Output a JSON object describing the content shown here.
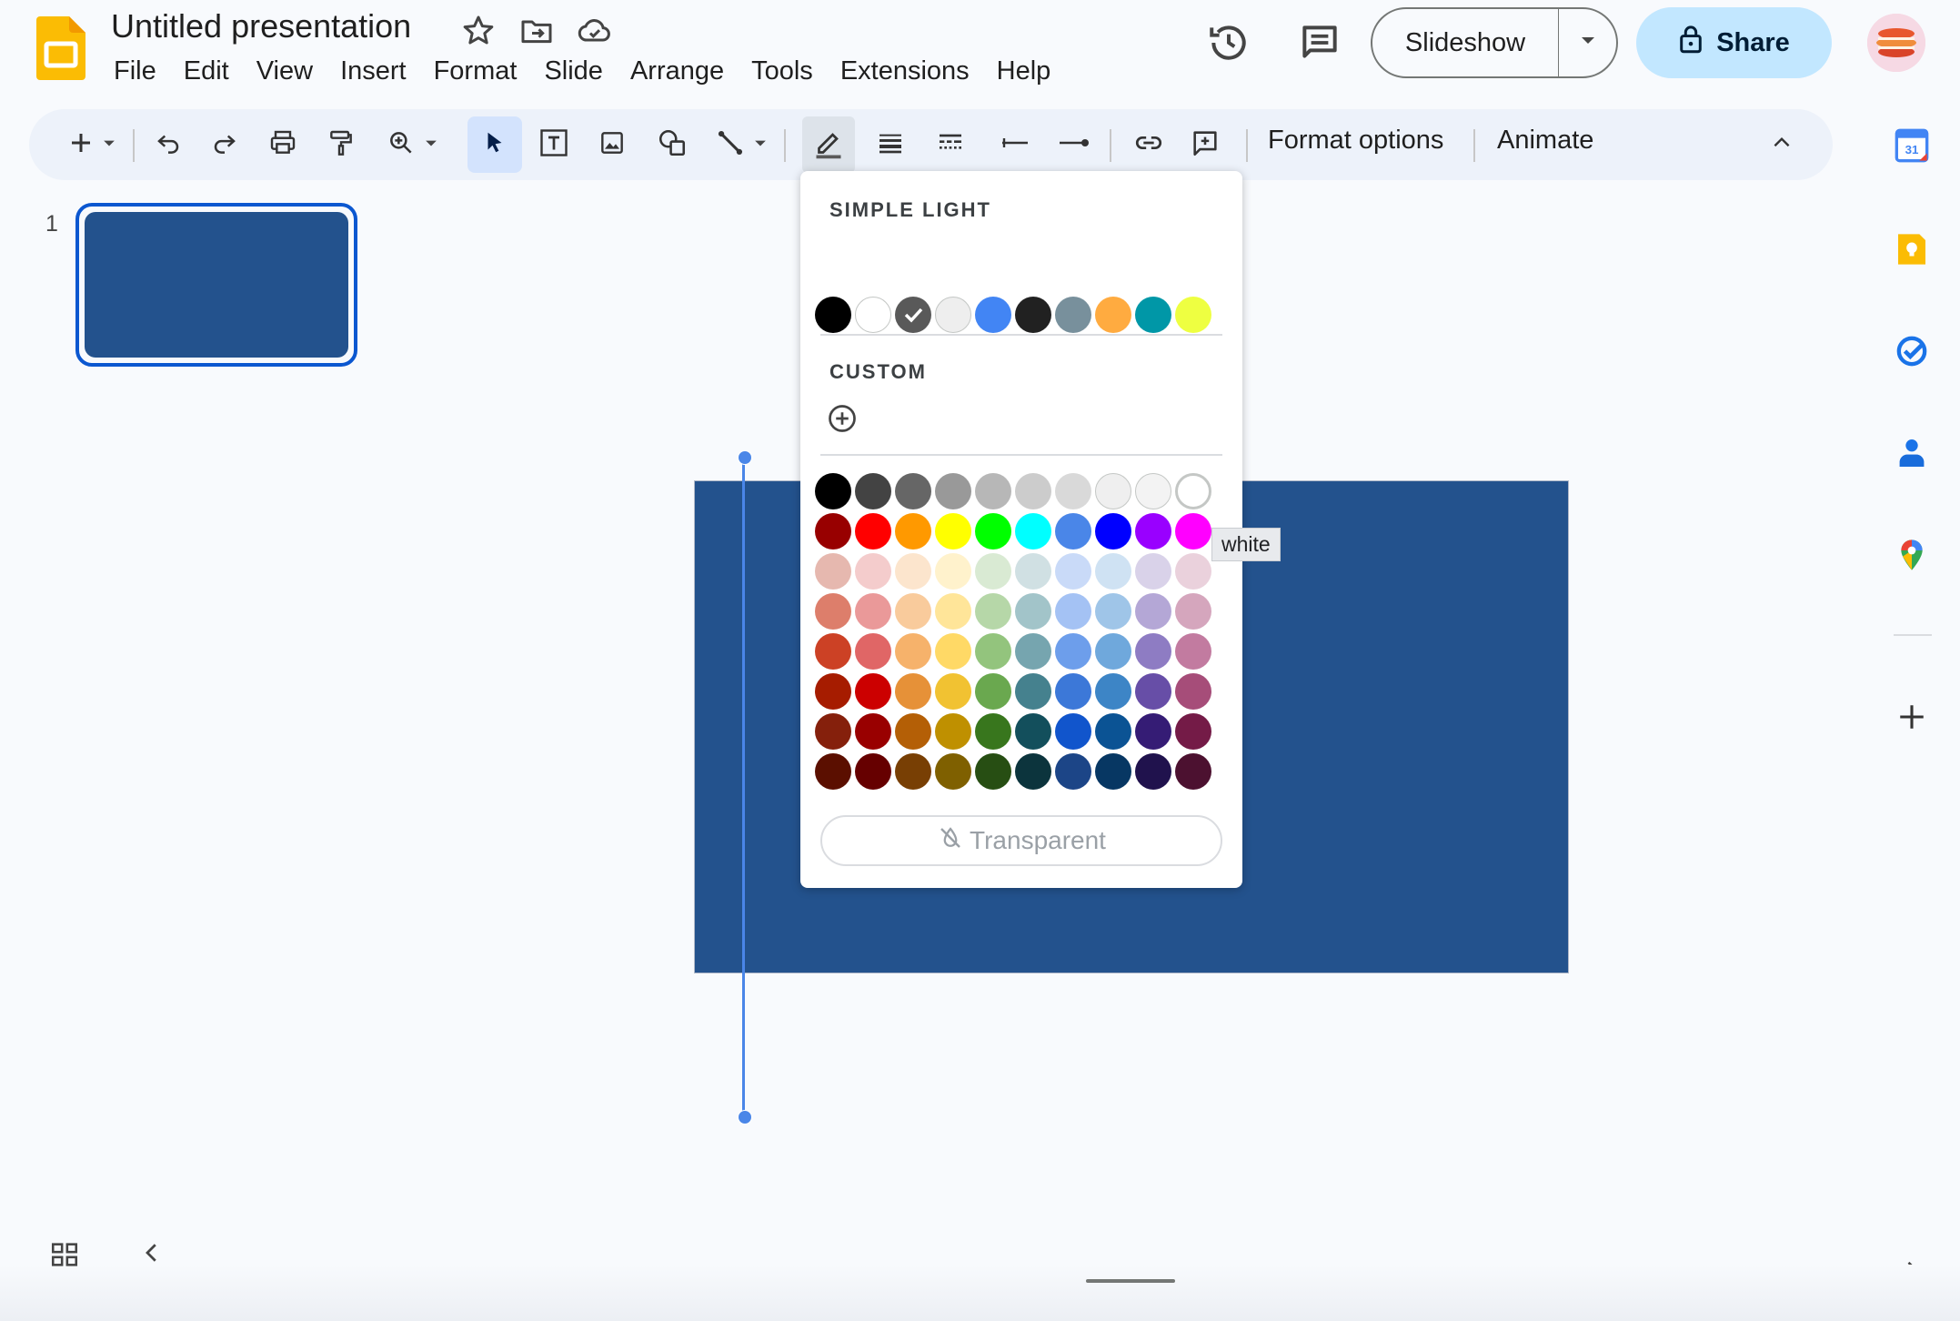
{
  "header": {
    "title": "Untitled presentation",
    "menu": [
      "File",
      "Edit",
      "View",
      "Insert",
      "Format",
      "Slide",
      "Arrange",
      "Tools",
      "Extensions",
      "Help"
    ],
    "slideshow_label": "Slideshow",
    "share_label": "Share"
  },
  "toolbar": {
    "format_options": "Format options",
    "animate": "Animate"
  },
  "filmstrip": {
    "slide_number": "1"
  },
  "color_picker": {
    "theme_label": "SIMPLE LIGHT",
    "custom_label": "CUSTOM",
    "transparent_label": "Transparent",
    "selected_theme_index": 2,
    "theme_colors": [
      "#000000",
      "#ffffff",
      "#595959",
      "#eeeeee",
      "#4285f4",
      "#212121",
      "#78909c",
      "#ffab40",
      "#0097a7",
      "#eeff41"
    ],
    "grid_colors": [
      [
        "#000000",
        "#434343",
        "#666666",
        "#999999",
        "#b7b7b7",
        "#cccccc",
        "#d9d9d9",
        "#efefef",
        "#f3f3f3",
        "#ffffff"
      ],
      [
        "#980000",
        "#ff0000",
        "#ff9900",
        "#ffff00",
        "#00ff00",
        "#00ffff",
        "#4a86e8",
        "#0000ff",
        "#9900ff",
        "#ff00ff"
      ],
      [
        "#e6b8af",
        "#f4cccc",
        "#fce5cd",
        "#fff2cc",
        "#d9ead3",
        "#d0e0e3",
        "#c9daf8",
        "#cfe2f3",
        "#d9d2e9",
        "#ead1dc"
      ],
      [
        "#dd7e6b",
        "#ea9999",
        "#f9cb9c",
        "#ffe599",
        "#b6d7a8",
        "#a2c4c9",
        "#a4c2f4",
        "#9fc5e8",
        "#b4a7d6",
        "#d5a6bd"
      ],
      [
        "#cc4125",
        "#e06666",
        "#f6b26b",
        "#ffd966",
        "#93c47d",
        "#76a5af",
        "#6d9eeb",
        "#6fa8dc",
        "#8e7cc3",
        "#c27ba0"
      ],
      [
        "#a61c00",
        "#cc0000",
        "#e69138",
        "#f1c232",
        "#6aa84f",
        "#45818e",
        "#3c78d8",
        "#3d85c6",
        "#674ea7",
        "#a64d79"
      ],
      [
        "#85200c",
        "#990000",
        "#b45f06",
        "#bf9000",
        "#38761d",
        "#134f5c",
        "#1155cc",
        "#0b5394",
        "#351c75",
        "#741b47"
      ],
      [
        "#5b0f00",
        "#660000",
        "#783f04",
        "#7f6000",
        "#274e13",
        "#0c343d",
        "#1c4587",
        "#073763",
        "#20124d",
        "#4c1130"
      ]
    ],
    "tooltip": "white"
  },
  "colors": {
    "accent": "#0b57d0",
    "slide_fill": "#23528d",
    "share_bg": "#c2e7ff",
    "line_color": "#4a86e8"
  }
}
